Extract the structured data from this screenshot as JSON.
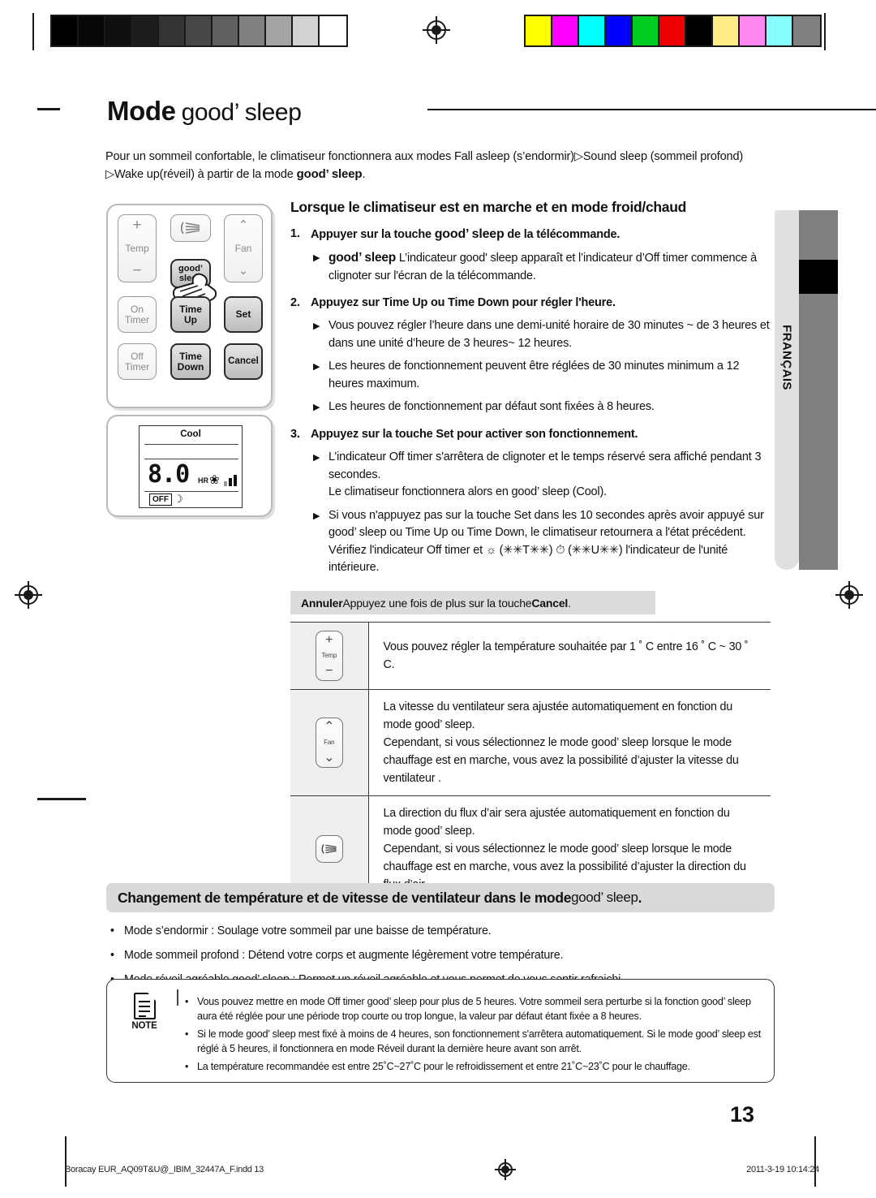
{
  "calibration": {
    "gray_steps": [
      "#000000",
      "#070707",
      "#101010",
      "#1d1d1d",
      "#343434",
      "#474747",
      "#606060",
      "#818181",
      "#a5a5a5",
      "#d2d2d2",
      "#ffffff"
    ],
    "color_steps": [
      "#ffff00",
      "#ff00ff",
      "#00ffff",
      "#0000ff",
      "#00cc22",
      "#ee0000",
      "#000000",
      "#ffee88",
      "#ff88ee",
      "#88ffff",
      "#808080"
    ]
  },
  "title": {
    "prefix": "Mode",
    "product": "good’ sleep"
  },
  "intro": {
    "line1": "Pour un sommeil confortable, le climatiseur fonctionnera aux modes Fall asleep (s’endormir)▷Sound sleep (sommeil profond)",
    "line2_pre": "▷Wake up(réveil) à partir de la mode ",
    "line2_gs": "good’ sleep",
    "line2_post": "."
  },
  "remote": {
    "buttons": {
      "temp": "Temp",
      "plus": "+",
      "minus": "−",
      "swing_icon": "swing-icon",
      "fan": "Fan",
      "chev_up": "⌃",
      "chev_down": "⌄",
      "good_sleep": "good’ sleep",
      "on_timer": "On Timer",
      "time_up": "Time Up",
      "set": "Set",
      "off_timer": "Off Timer",
      "time_down": "Time Down",
      "cancel": "Cancel"
    },
    "lcd": {
      "mode": "Cool",
      "value": "8.0",
      "unit": "HR",
      "off_badge": "OFF",
      "fan_icon": "fan-icon",
      "sleep_icon": "sleep-icon",
      "signal_bars": [
        6,
        10,
        14
      ]
    }
  },
  "section": {
    "heading": "Lorsque le climatiseur est en marche et en mode froid/chaud",
    "steps": [
      {
        "num": "1.",
        "text_pre": "Appuyer sur la touche ",
        "text_gs": "good’ sleep",
        "text_post": " de la télécommande.",
        "bullets": [
          {
            "gs_lead": "good’ sleep",
            "text": " L’indicateur good' sleep apparaît et  l’indicateur d’Off timer commence à clignoter sur l'écran de la télécommande."
          }
        ]
      },
      {
        "num": "2.",
        "text_pre": "Appuyez sur Time Up ou Time Down pour régler l'heure.",
        "text_gs": "",
        "text_post": "",
        "bullets": [
          {
            "gs_lead": "",
            "text": "Vous pouvez régler l’heure dans une demi-unité horaire de 30 minutes ~ de 3 heures et dans une unité d’heure de 3 heures~ 12 heures."
          },
          {
            "gs_lead": "",
            "text": "Les heures de fonctionnement peuvent être réglées de 30 minutes minimum a 12 heures maximum."
          },
          {
            "gs_lead": "",
            "text": "Les heures de fonctionnement par défaut sont fixées à 8 heures."
          }
        ]
      },
      {
        "num": "3.",
        "text_pre": "Appuyez sur la touche Set pour activer son fonctionnement.",
        "text_gs": "",
        "text_post": "",
        "bullets": [
          {
            "gs_lead": "",
            "text": "L’indicateur Off timer s'arrêtera de clignoter et le temps réservé sera affiché pendant 3 secondes."
          },
          {
            "gs_lead": "",
            "text": "Si vous n'appuyez pas sur la touche Set dans les 10 secondes après avoir appuyé sur good’ sleep ou Time Up ou Time Down, le climatiseur retournera a l'état précédent. Vérifiez l'indicateur Off timer et ☼ (✳✳T✳✳) ⏱ (✳✳U✳✳) l'indicateur de l'unité intérieure."
          }
        ],
        "sub_line": "Le climatiseur fonctionnera alors en good’ sleep (Cool)."
      }
    ]
  },
  "annuler": {
    "label": "Annuler",
    "text_pre": "  Appuyez une fois de plus sur la touche ",
    "text_bold": "Cancel",
    "text_post": "."
  },
  "table": {
    "rows": [
      {
        "icon": "temp-button-icon",
        "icon_label": "Temp",
        "lines": [
          {
            "text": "Vous pouvez régler la température souhaitée par 1 ˚ C entre 16 ˚ C ~ 30 ˚ C."
          }
        ]
      },
      {
        "icon": "fan-button-icon",
        "icon_label": "Fan",
        "lines": [
          {
            "text": "La vitesse du ventilateur sera ajustée automatiquement en fonction du mode good’ sleep."
          },
          {
            "text": "Cependant, si vous sélectionnez le mode good’ sleep lorsque le mode chauffage est en marche, vous avez la possibilité d’ajuster la vitesse du ventilateur ."
          }
        ]
      },
      {
        "icon": "swing-button-icon",
        "icon_label": "",
        "lines": [
          {
            "text": "La direction du flux d’air sera ajustée automatiquement en fonction du mode good’ sleep."
          },
          {
            "text": "Cependant, si vous sélectionnez le mode good’ sleep lorsque le mode chauffage est en marche, vous avez la possibilité d’ajuster la direction du flux d’air ."
          }
        ]
      }
    ]
  },
  "bottom": {
    "pill_pre": "Changement de température et de vitesse de ventilateur dans le mode  ",
    "pill_gs": "good’ sleep",
    "pill_post": ".",
    "items": [
      "Mode s’endormir : Soulage votre sommeil par une baisse de température.",
      "Mode sommeil profond : Détend votre corps et augmente légèrement votre température.",
      "Mode réveil agréable good’ sleep : Permet un réveil agréable et vous permet de vous sentir rafraichi."
    ]
  },
  "note": {
    "label": "NOTE",
    "icon": "note-document-icon",
    "items": [
      "Vous pouvez mettre en mode Off timer good’ sleep pour plus de 5 heures. Votre sommeil sera perturbe si la fonction good’ sleep aura été réglée pour une période trop courte ou trop longue, la valeur par défaut étant fixée a 8 heures.",
      "Si le mode good’ sleep mest fixé à moins de 4 heures, son fonctionnement s'arrêtera automatiquement. Si le mode good’ sleep est réglé à 5 heures, il fonctionnera en mode Réveil durant la dernière heure avant son arrêt.",
      "La température recommandée est entre 25˚C~27˚C pour le refroidissement et entre 21˚C~23˚C pour le chauffage."
    ]
  },
  "side_tab": {
    "language": "FRANÇAIS"
  },
  "page_number": "13",
  "footer": {
    "file": "Boracay EUR_AQ09T&U@_IBIM_32447A_F.indd   13",
    "marker": "registration-mark",
    "timestamp": "2011-3-19   10:14:24"
  }
}
